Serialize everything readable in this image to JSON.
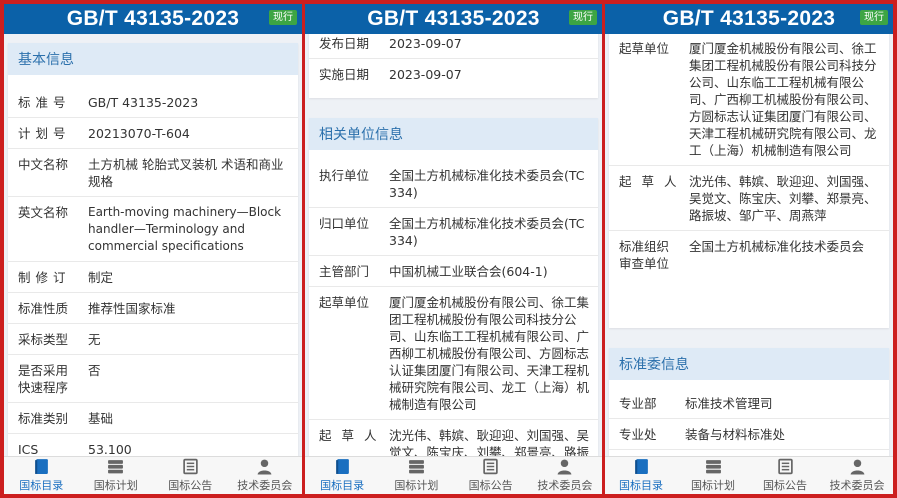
{
  "header": {
    "title": "GB/T 43135-2023",
    "badge": "现行"
  },
  "tabs": [
    {
      "label": "国标目录"
    },
    {
      "label": "国标计划"
    },
    {
      "label": "国标公告"
    },
    {
      "label": "技术委员会"
    }
  ],
  "basic": {
    "title": "基本信息",
    "std_no_label": "标准号",
    "std_no": "GB/T 43135-2023",
    "plan_no_label": "计划号",
    "plan_no": "20213070-T-604",
    "cn_name_label": "中文名称",
    "cn_name": "土方机械 轮胎式叉装机 术语和商业规格",
    "en_name_label": "英文名称",
    "en_name": "Earth-moving machinery—Block handler—Terminology and commercial specifications",
    "revise_label": "制修订",
    "revise": "制定",
    "nature_label": "标准性质",
    "nature": "推荐性国家标准",
    "adopt_type_label": "采标类型",
    "adopt_type": "无",
    "fast_label": "是否采用快速程序",
    "fast": "否",
    "category_label": "标准类别",
    "category": "基础",
    "ics_label": "ICS",
    "ics": "53.100",
    "publish_label": "发布日期",
    "publish": "2023-09-07",
    "implement_label": "实施日期",
    "implement": "2023-09-07"
  },
  "units": {
    "title": "相关单位信息",
    "exec_label": "执行单位",
    "exec": "全国土方机械标准化技术委员会(TC334)",
    "belong_label": "归口单位",
    "belong": "全国土方机械标准化技术委员会(TC334)",
    "dept_label": "主管部门",
    "dept": "中国机械工业联合会(604-1)",
    "drafter_unit_label": "起草单位",
    "drafter_unit": "厦门厦金机械股份有限公司、徐工集团工程机械股份有限公司科技分公司、山东临工工程机械有限公司、广西柳工机械股份有限公司、方圆标志认证集团厦门有限公司、天津工程机械研究院有限公司、龙工（上海）机械制造有限公司",
    "drafter_label": "起草人",
    "drafter": "沈光伟、韩嫔、耿迎迎、刘国强、吴觉文、陈宝庆、刘攀、郑景亮、路振坡、邹广平、周燕萍",
    "review_label": "标准组织审查单位",
    "review": "全国土方机械标准化技术委员会"
  },
  "committee": {
    "title": "标准委信息",
    "dept_label": "专业部",
    "dept": "标准技术管理司",
    "office_label": "专业处",
    "office": "装备与材料标准处"
  }
}
